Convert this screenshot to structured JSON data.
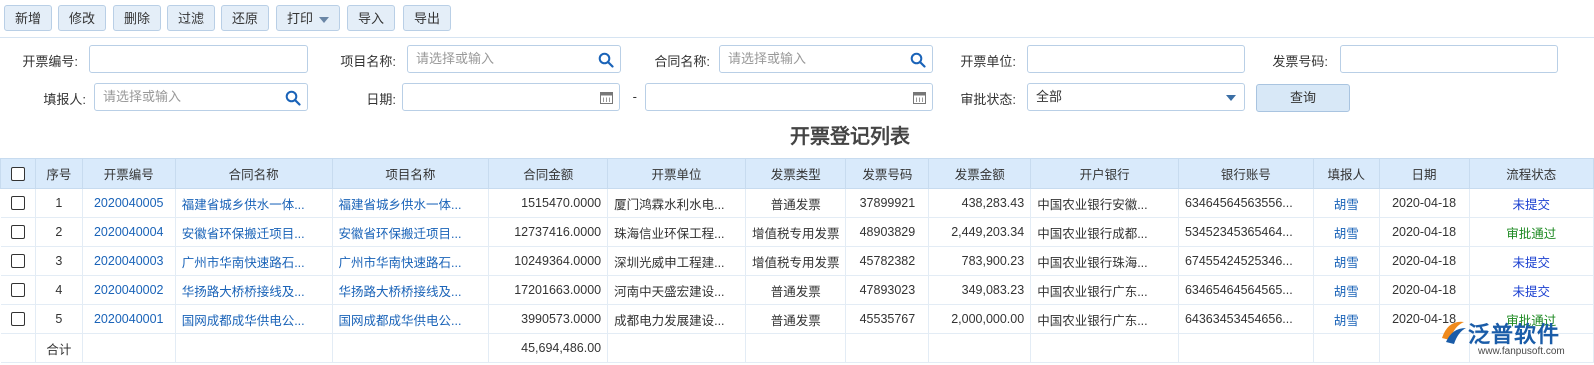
{
  "toolbar": {
    "buttons": [
      {
        "label": "新增"
      },
      {
        "label": "修改"
      },
      {
        "label": "删除"
      },
      {
        "label": "过滤"
      },
      {
        "label": "还原"
      },
      {
        "label": "打印"
      },
      {
        "label": "导入"
      },
      {
        "label": "导出"
      }
    ]
  },
  "filters": {
    "invoice_no_label": "开票编号:",
    "project_name_label": "项目名称:",
    "project_name_placeholder": "请选择或输入",
    "contract_name_label": "合同名称:",
    "contract_name_placeholder": "请选择或输入",
    "invoice_unit_label": "开票单位:",
    "invoice_number_label": "发票号码:",
    "reporter_label": "填报人:",
    "reporter_placeholder": "请选择或输入",
    "date_label": "日期:",
    "date_separator": "-",
    "status_label": "审批状态:",
    "status_value": "全部",
    "query_button": "查询"
  },
  "table": {
    "title": "开票登记列表",
    "headers": [
      "序号",
      "开票编号",
      "合同名称",
      "项目名称",
      "合同金额",
      "开票单位",
      "发票类型",
      "发票号码",
      "发票金额",
      "开户银行",
      "银行账号",
      "填报人",
      "日期",
      "流程状态"
    ],
    "rows": [
      {
        "seq": "1",
        "invoice_no": "2020040005",
        "contract": "福建省城乡供水一体...",
        "project": "福建省城乡供水一体...",
        "contract_amount": "1515470.0000",
        "unit": "厦门鸿霖水利水电...",
        "type": "普通发票",
        "invoice_number": "37899921",
        "invoice_amount": "438,283.43",
        "bank": "中国农业银行安徽...",
        "account": "63464564563556...",
        "reporter": "胡雪",
        "date": "2020-04-18",
        "status": "未提交",
        "status_kind": "unsubmitted"
      },
      {
        "seq": "2",
        "invoice_no": "2020040004",
        "contract": "安徽省环保搬迁项目...",
        "project": "安徽省环保搬迁项目...",
        "contract_amount": "12737416.0000",
        "unit": "珠海信业环保工程...",
        "type": "增值税专用发票",
        "invoice_number": "48903829",
        "invoice_amount": "2,449,203.34",
        "bank": "中国农业银行成都...",
        "account": "53452345365464...",
        "reporter": "胡雪",
        "date": "2020-04-18",
        "status": "审批通过",
        "status_kind": "approved"
      },
      {
        "seq": "3",
        "invoice_no": "2020040003",
        "contract": "广州市华南快速路石...",
        "project": "广州市华南快速路石...",
        "contract_amount": "10249364.0000",
        "unit": "深圳光威申工程建...",
        "type": "增值税专用发票",
        "invoice_number": "45782382",
        "invoice_amount": "783,900.23",
        "bank": "中国农业银行珠海...",
        "account": "67455424525346...",
        "reporter": "胡雪",
        "date": "2020-04-18",
        "status": "未提交",
        "status_kind": "unsubmitted"
      },
      {
        "seq": "4",
        "invoice_no": "2020040002",
        "contract": "华扬路大桥桥接线及...",
        "project": "华扬路大桥桥接线及...",
        "contract_amount": "17201663.0000",
        "unit": "河南中天盛宏建设...",
        "type": "普通发票",
        "invoice_number": "47893023",
        "invoice_amount": "349,083.23",
        "bank": "中国农业银行广东...",
        "account": "63465464564565...",
        "reporter": "胡雪",
        "date": "2020-04-18",
        "status": "未提交",
        "status_kind": "unsubmitted"
      },
      {
        "seq": "5",
        "invoice_no": "2020040001",
        "contract": "国网成都成华供电公...",
        "project": "国网成都成华供电公...",
        "contract_amount": "3990573.0000",
        "unit": "成都电力发展建设...",
        "type": "普通发票",
        "invoice_number": "45535767",
        "invoice_amount": "2,000,000.00",
        "bank": "中国农业银行广东...",
        "account": "64363453454656...",
        "reporter": "胡雪",
        "date": "2020-04-18",
        "status": "审批通过",
        "status_kind": "approved"
      }
    ],
    "summary": {
      "label": "合计",
      "contract_total": "45,694,486.00"
    }
  },
  "logo": {
    "name": "泛普软件",
    "url": "www.fanpusoft.com"
  },
  "colors": {
    "link": "#1a63b8",
    "unsubmitted": "#1a3fd0",
    "approved": "#1e8a23",
    "header_bg": "#d9eafb"
  }
}
